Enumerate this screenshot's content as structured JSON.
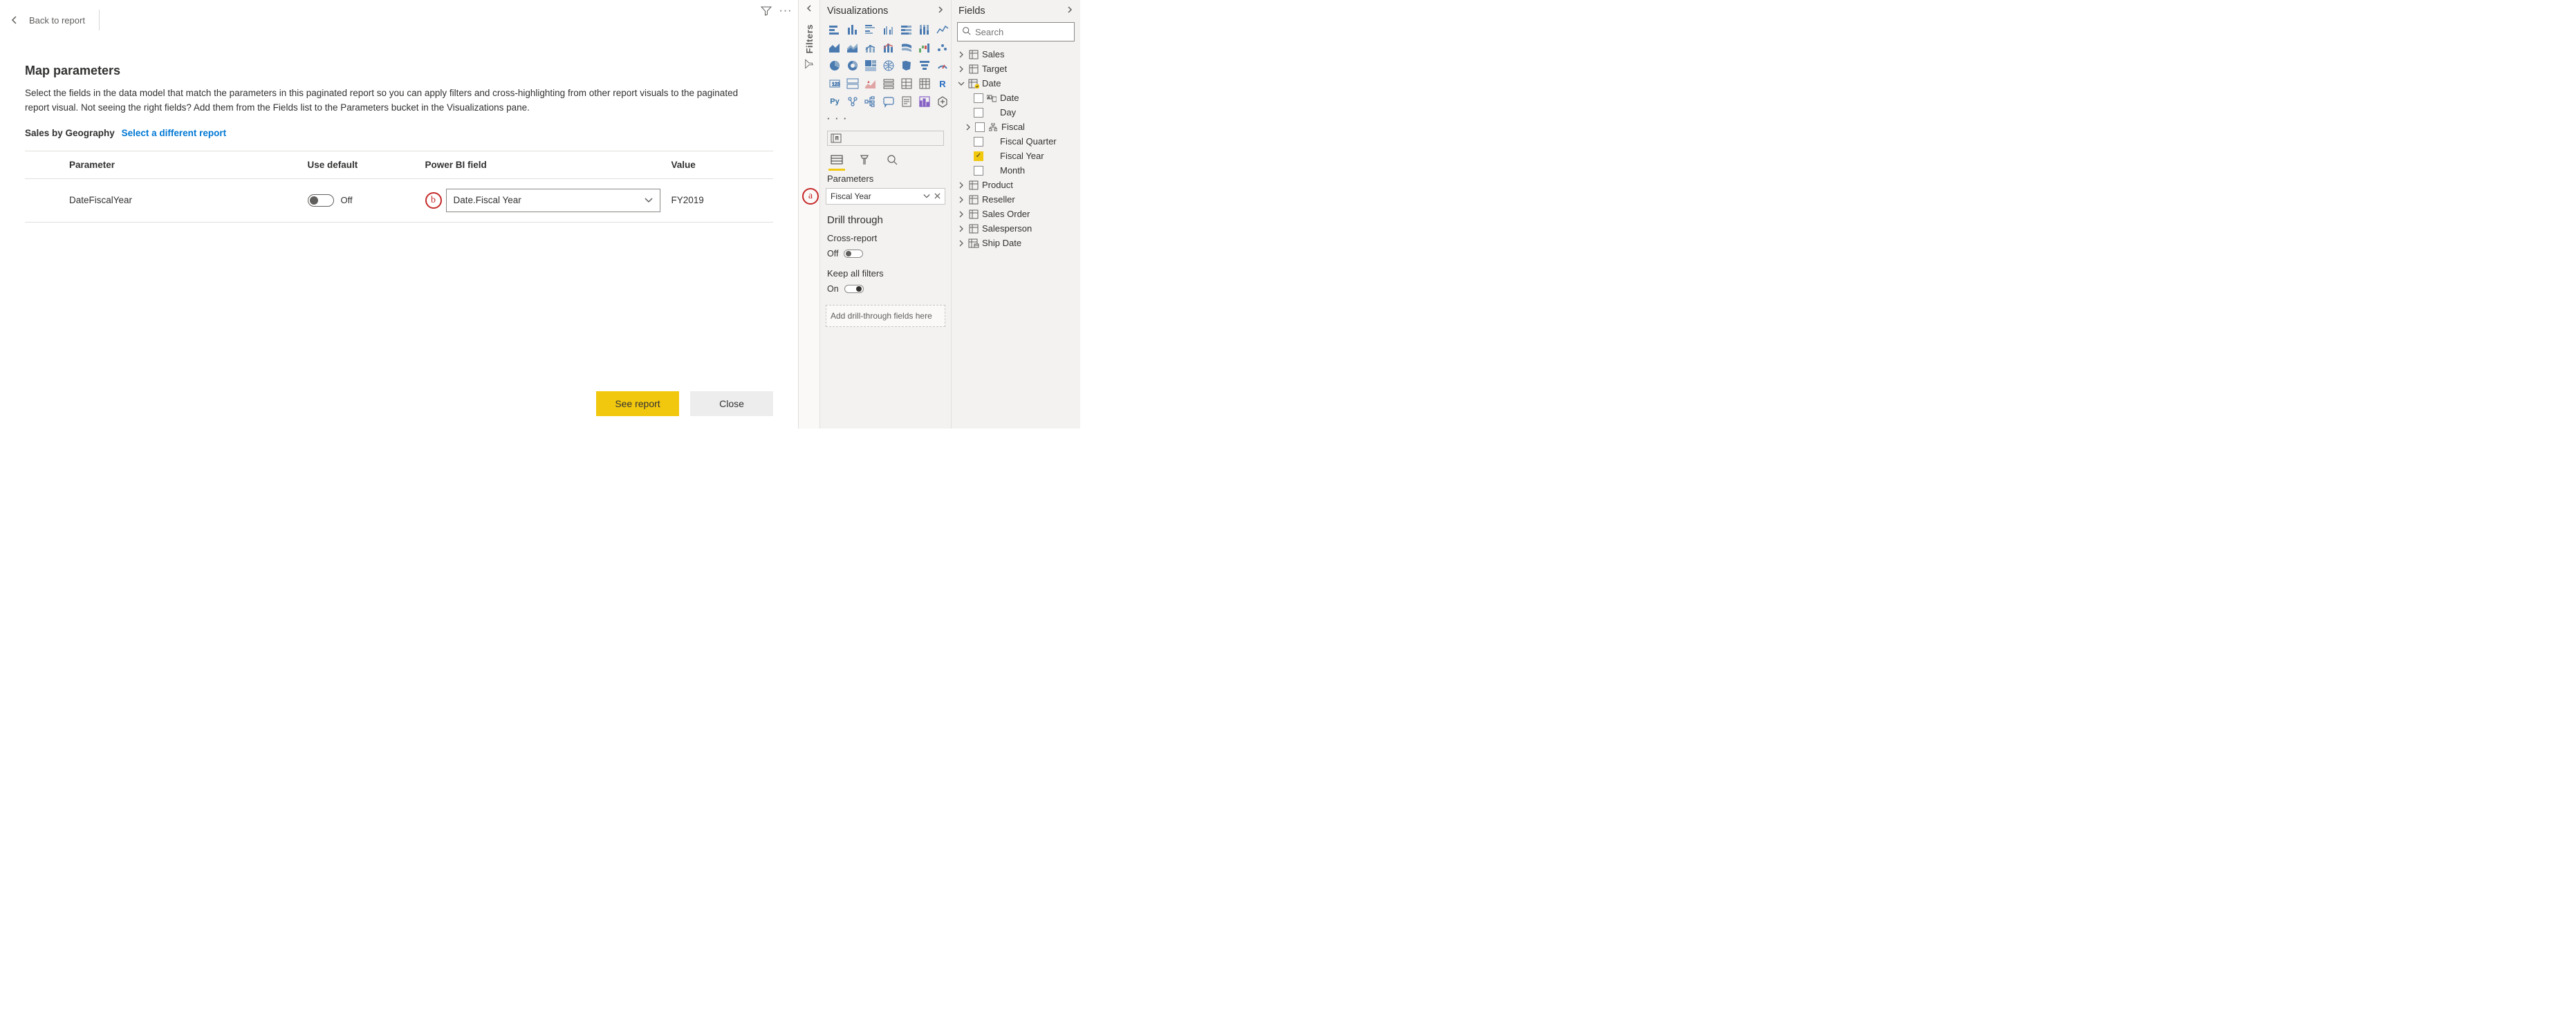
{
  "toolbar": {
    "back_label": "Back to report"
  },
  "main": {
    "title": "Map parameters",
    "description": "Select the fields in the data model that match the parameters in this paginated report so you can apply filters and cross-highlighting from other report visuals to the paginated report visual. Not seeing the right fields? Add them from the Fields list to the Parameters bucket in the Visualizations pane.",
    "report_name": "Sales by Geography",
    "select_different": "Select a different report",
    "columns": {
      "parameter": "Parameter",
      "use_default": "Use default",
      "field": "Power BI field",
      "value": "Value"
    },
    "rows": [
      {
        "parameter": "DateFiscalYear",
        "use_default_state": "Off",
        "field": "Date.Fiscal Year",
        "value": "FY2019"
      }
    ],
    "buttons": {
      "primary": "See report",
      "secondary": "Close"
    },
    "callouts": {
      "a": "a",
      "b": "b"
    }
  },
  "filters": {
    "label": "Filters"
  },
  "viz": {
    "title": "Visualizations",
    "icons": [
      "stacked-bar",
      "stacked-column",
      "clustered-bar",
      "clustered-column",
      "100-stacked-bar",
      "100-stacked-column",
      "line",
      "area",
      "stacked-area",
      "line-clustered",
      "line-stacked",
      "ribbon",
      "waterfall",
      "scatter",
      "pie",
      "donut",
      "treemap",
      "map",
      "filled-map",
      "gauge",
      "card",
      "multi-card",
      "kpi",
      "slicer",
      "table",
      "matrix",
      "r-visual",
      "py-visual",
      "key-influencer",
      "decomposition",
      "qna",
      "paginated",
      "power-apps",
      "ai",
      "more-visual"
    ],
    "more": "· · ·",
    "parameters_label": "Parameters",
    "chip": {
      "text": "Fiscal Year"
    },
    "drill": {
      "title": "Drill through",
      "cross_report": "Cross-report",
      "cross_state": "Off",
      "keep_filters": "Keep all filters",
      "keep_state": "On",
      "drop_text": "Add drill-through fields here"
    }
  },
  "fields": {
    "title": "Fields",
    "search_placeholder": "Search",
    "tables": [
      {
        "name": "Sales",
        "expanded": false
      },
      {
        "name": "Target",
        "expanded": false
      },
      {
        "name": "Date",
        "expanded": true,
        "marked": true,
        "children": [
          {
            "name": "Date",
            "type": "date-hierarchy",
            "checked": false
          },
          {
            "name": "Day",
            "type": "field",
            "checked": false
          },
          {
            "name": "Fiscal",
            "type": "hierarchy",
            "checked": false,
            "expandable": true
          },
          {
            "name": "Fiscal Quarter",
            "type": "field",
            "checked": false
          },
          {
            "name": "Fiscal Year",
            "type": "field",
            "checked": true
          },
          {
            "name": "Month",
            "type": "field",
            "checked": false
          }
        ]
      },
      {
        "name": "Product",
        "expanded": false
      },
      {
        "name": "Reseller",
        "expanded": false
      },
      {
        "name": "Sales Order",
        "expanded": false
      },
      {
        "name": "Salesperson",
        "expanded": false
      },
      {
        "name": "Ship Date",
        "expanded": false,
        "icon": "date-table"
      }
    ]
  }
}
